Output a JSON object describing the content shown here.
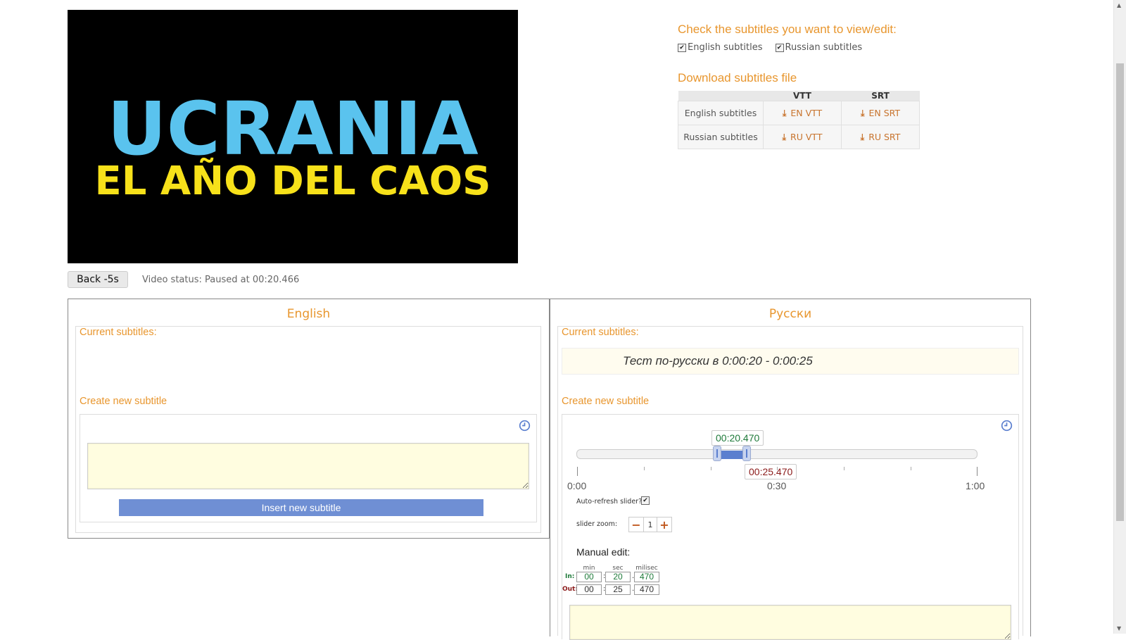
{
  "video": {
    "title_line1": "UCRANIA",
    "title_line2": "EL AÑO DEL CAOS",
    "colors": {
      "line1": "#5ac3ee",
      "line2": "#f7e11a",
      "bg": "#000000"
    }
  },
  "sidebar": {
    "check_heading": "Check the subtitles you want to view/edit:",
    "checkboxes": [
      {
        "label": "English subtitles",
        "checked": true
      },
      {
        "label": "Russian subtitles",
        "checked": true
      }
    ],
    "download_heading": "Download subtitles file",
    "table": {
      "headers": [
        "",
        "VTT",
        "SRT"
      ],
      "rows": [
        {
          "label": "English subtitles",
          "vtt": "EN VTT",
          "srt": "EN SRT"
        },
        {
          "label": "Russian subtitles",
          "vtt": "RU VTT",
          "srt": "RU SRT"
        }
      ]
    }
  },
  "controls": {
    "back_button": "Back -5s",
    "status": "Video status: Paused at 00:20.466"
  },
  "english": {
    "title": "English",
    "current_label": "Current subtitles:",
    "create_label": "Create new subtitle",
    "insert_button": "Insert new subtitle"
  },
  "russian": {
    "title": "Русски",
    "current_label": "Current subtitles:",
    "current_text": "Тест по-русски в 0:00:20 - 0:00:25",
    "create_label": "Create new subtitle",
    "slider": {
      "in_time": "00:20.470",
      "out_time": "00:25.470",
      "tick_labels": [
        "0:00",
        "0:30",
        "1:00"
      ],
      "range_start_sec": 20.47,
      "range_end_sec": 25.47,
      "max_sec": 60
    },
    "auto_refresh_label": "Auto-refresh slider?",
    "auto_refresh_checked": true,
    "zoom_label": "slider zoom:",
    "zoom_value": "1",
    "manual_title": "Manual edit:",
    "manual_headers": [
      "min",
      "sec",
      "milisec"
    ],
    "in_label": "In:",
    "out_label": "Out:",
    "in_values": [
      "00",
      "20",
      "470"
    ],
    "out_values": [
      "00",
      "25",
      "470"
    ]
  },
  "accent_color": "#e8962e"
}
